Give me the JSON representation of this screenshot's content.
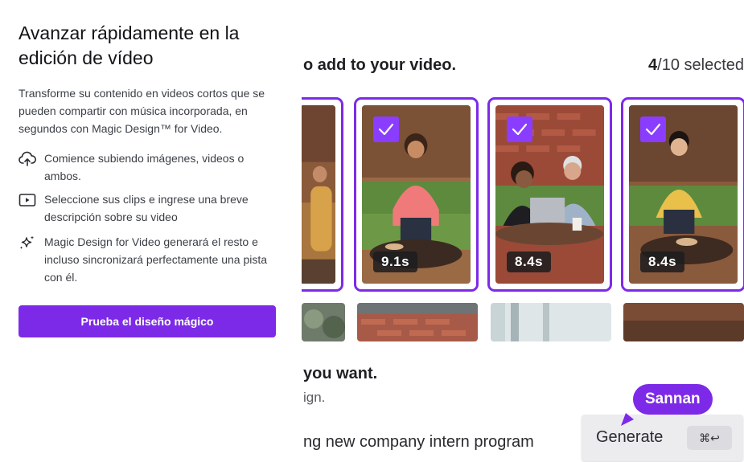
{
  "left": {
    "title": "Avanzar rápidamente en la edición de vídeo",
    "description": "Transforme su contenido en videos cortos que se pueden compartir con música incorporada, en segundos con Magic Design™ for Video.",
    "features": [
      {
        "icon": "cloud-upload-icon",
        "text": "Comience subiendo imágenes, videos o ambos."
      },
      {
        "icon": "play-video-icon",
        "text": "Seleccione sus clips e ingrese una breve descripción sobre su video"
      },
      {
        "icon": "sparkle-icon",
        "text": "Magic Design for Video generará el resto e incluso sincronizará perfectamente una pista con él."
      }
    ],
    "cta_label": "Prueba el diseño mágico",
    "accent_color": "#7d2ae8"
  },
  "preview": {
    "heading": "o add to your video.",
    "selected_count": "4",
    "selected_total": "/10 selected",
    "clips": [
      {
        "duration": "",
        "selected": false
      },
      {
        "duration": "9.1s",
        "selected": true
      },
      {
        "duration": "8.4s",
        "selected": true
      },
      {
        "duration": "8.4s",
        "selected": true
      }
    ],
    "prompt_heading": "you want.",
    "prompt_sub": "ign.",
    "prompt_text": "ng new company intern program",
    "generate_label": "Generate",
    "shortcut": "⌘↩",
    "cursor_name": "Sannan"
  }
}
